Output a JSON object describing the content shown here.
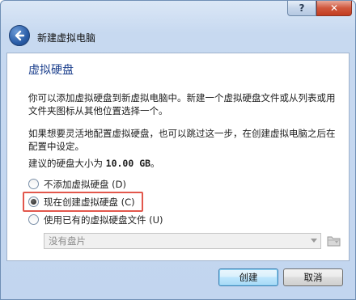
{
  "window": {
    "help_label": "?",
    "close_label": "✕"
  },
  "header": {
    "title": "新建虚拟电脑",
    "back_icon": "back-arrow-icon"
  },
  "page": {
    "title": "虚拟硬盘",
    "paragraph1": "你可以添加虚拟硬盘到新虚拟电脑中。新建一个虚拟硬盘文件或从列表或用文件夹图标从其他位置选择一个。",
    "paragraph2": "如果想要灵活地配置虚拟硬盘，也可以跳过这一步，在创建虚拟电脑之后在配置中设定。",
    "recommended_prefix": "建议的硬盘大小为 ",
    "recommended_size": "10.00 GB",
    "recommended_suffix": "。"
  },
  "options": [
    {
      "label": "不添加虚拟硬盘 (D)",
      "selected": false
    },
    {
      "label": "现在创建虚拟硬盘 (C)",
      "selected": true
    },
    {
      "label": "使用已有的虚拟硬盘文件 (U)",
      "selected": false
    }
  ],
  "disk_select": {
    "value": "没有盘片",
    "enabled": false
  },
  "buttons": {
    "create": "创建",
    "cancel": "取消"
  },
  "colors": {
    "title": "#1a3e8c",
    "highlight": "#e2574c"
  }
}
